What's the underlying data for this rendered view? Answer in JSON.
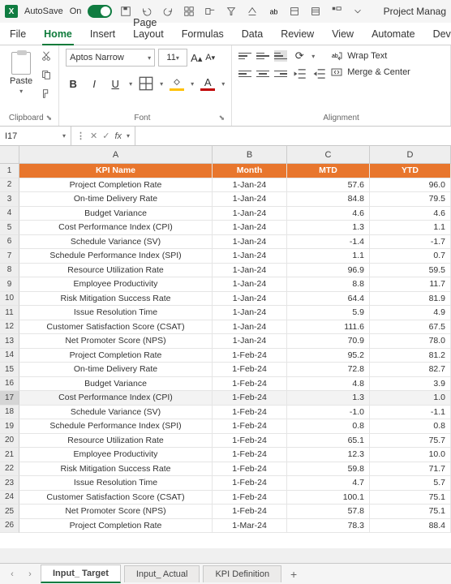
{
  "titlebar": {
    "autosave_label": "AutoSave",
    "autosave_state": "On",
    "doc_title": "Project Manag"
  },
  "ribbon_tabs": [
    "File",
    "Home",
    "Insert",
    "Page Layout",
    "Formulas",
    "Data",
    "Review",
    "View",
    "Automate",
    "Devel"
  ],
  "active_tab": "Home",
  "clipboard": {
    "paste_label": "Paste",
    "group_label": "Clipboard"
  },
  "font": {
    "name": "Aptos Narrow",
    "size": "11",
    "group_label": "Font",
    "bold": "B",
    "italic": "I",
    "underline": "U",
    "inc_label": "A",
    "dec_label": "A"
  },
  "alignment": {
    "group_label": "Alignment",
    "wrap_label": "Wrap Text",
    "merge_label": "Merge & Center"
  },
  "namebox": "I17",
  "fx_label": "fx",
  "columns": [
    "A",
    "B",
    "C",
    "D"
  ],
  "headers": {
    "A": "KPI Name",
    "B": "Month",
    "C": "MTD",
    "D": "YTD"
  },
  "rows": [
    {
      "n": 2,
      "a": "Project Completion Rate",
      "b": "1-Jan-24",
      "c": "57.6",
      "d": "96.0"
    },
    {
      "n": 3,
      "a": "On-time Delivery Rate",
      "b": "1-Jan-24",
      "c": "84.8",
      "d": "79.5"
    },
    {
      "n": 4,
      "a": "Budget Variance",
      "b": "1-Jan-24",
      "c": "4.6",
      "d": "4.6"
    },
    {
      "n": 5,
      "a": "Cost Performance Index (CPI)",
      "b": "1-Jan-24",
      "c": "1.3",
      "d": "1.1"
    },
    {
      "n": 6,
      "a": "Schedule Variance (SV)",
      "b": "1-Jan-24",
      "c": "-1.4",
      "d": "-1.7"
    },
    {
      "n": 7,
      "a": "Schedule Performance Index (SPI)",
      "b": "1-Jan-24",
      "c": "1.1",
      "d": "0.7"
    },
    {
      "n": 8,
      "a": "Resource Utilization Rate",
      "b": "1-Jan-24",
      "c": "96.9",
      "d": "59.5"
    },
    {
      "n": 9,
      "a": "Employee Productivity",
      "b": "1-Jan-24",
      "c": "8.8",
      "d": "11.7"
    },
    {
      "n": 10,
      "a": "Risk Mitigation Success Rate",
      "b": "1-Jan-24",
      "c": "64.4",
      "d": "81.9"
    },
    {
      "n": 11,
      "a": "Issue Resolution Time",
      "b": "1-Jan-24",
      "c": "5.9",
      "d": "4.9"
    },
    {
      "n": 12,
      "a": "Customer Satisfaction Score (CSAT)",
      "b": "1-Jan-24",
      "c": "111.6",
      "d": "67.5"
    },
    {
      "n": 13,
      "a": "Net Promoter Score (NPS)",
      "b": "1-Jan-24",
      "c": "70.9",
      "d": "78.0"
    },
    {
      "n": 14,
      "a": "Project Completion Rate",
      "b": "1-Feb-24",
      "c": "95.2",
      "d": "81.2"
    },
    {
      "n": 15,
      "a": "On-time Delivery Rate",
      "b": "1-Feb-24",
      "c": "72.8",
      "d": "82.7"
    },
    {
      "n": 16,
      "a": "Budget Variance",
      "b": "1-Feb-24",
      "c": "4.8",
      "d": "3.9"
    },
    {
      "n": 17,
      "a": "Cost Performance Index (CPI)",
      "b": "1-Feb-24",
      "c": "1.3",
      "d": "1.0"
    },
    {
      "n": 18,
      "a": "Schedule Variance (SV)",
      "b": "1-Feb-24",
      "c": "-1.0",
      "d": "-1.1"
    },
    {
      "n": 19,
      "a": "Schedule Performance Index (SPI)",
      "b": "1-Feb-24",
      "c": "0.8",
      "d": "0.8"
    },
    {
      "n": 20,
      "a": "Resource Utilization Rate",
      "b": "1-Feb-24",
      "c": "65.1",
      "d": "75.7"
    },
    {
      "n": 21,
      "a": "Employee Productivity",
      "b": "1-Feb-24",
      "c": "12.3",
      "d": "10.0"
    },
    {
      "n": 22,
      "a": "Risk Mitigation Success Rate",
      "b": "1-Feb-24",
      "c": "59.8",
      "d": "71.7"
    },
    {
      "n": 23,
      "a": "Issue Resolution Time",
      "b": "1-Feb-24",
      "c": "4.7",
      "d": "5.7"
    },
    {
      "n": 24,
      "a": "Customer Satisfaction Score (CSAT)",
      "b": "1-Feb-24",
      "c": "100.1",
      "d": "75.1"
    },
    {
      "n": 25,
      "a": "Net Promoter Score (NPS)",
      "b": "1-Feb-24",
      "c": "57.8",
      "d": "75.1"
    },
    {
      "n": 26,
      "a": "Project Completion Rate",
      "b": "1-Mar-24",
      "c": "78.3",
      "d": "88.4"
    }
  ],
  "selected_row": 17,
  "sheet_tabs": [
    "Input_ Target",
    "Input_ Actual",
    "KPI Definition"
  ],
  "active_sheet": "Input_ Target",
  "add_sheet_label": "+"
}
